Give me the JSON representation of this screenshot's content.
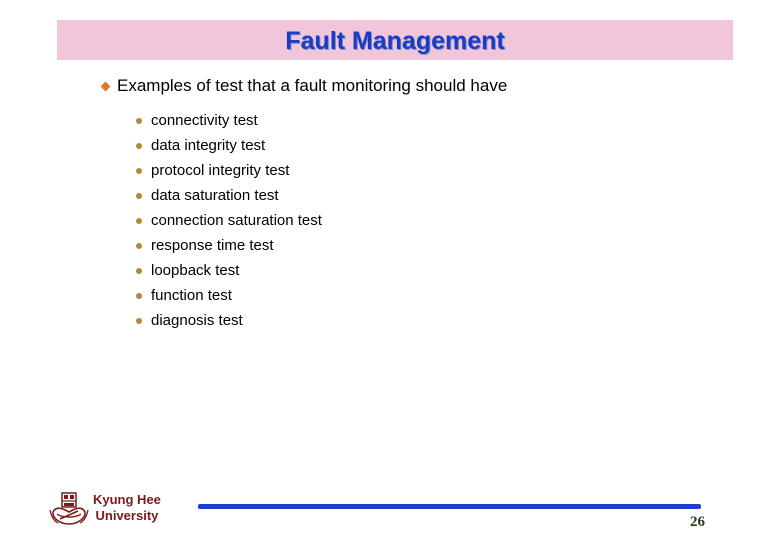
{
  "slide": {
    "title": "Fault Management",
    "main_point": "Examples of test that a fault monitoring should have",
    "sub_items": [
      "connectivity test",
      "data integrity test",
      "protocol integrity test",
      "data saturation test",
      "connection saturation test",
      "response time test",
      "loopback test",
      "function test",
      "diagnosis test"
    ]
  },
  "footer": {
    "university_line1": "Kyung Hee",
    "university_line2": "University",
    "page_number": "26"
  },
  "colors": {
    "title_bg": "#f2c6da",
    "title_text": "#1a3bc4",
    "main_bullet": "#e07a2a",
    "sub_bullet": "#b08a3a",
    "university_text": "#7a1a1a",
    "footer_line": "#1d3fd0"
  },
  "icons": {
    "main_bullet": "diamond-bullet-icon",
    "sub_bullet": "dot-bullet-icon",
    "logo": "university-emblem-icon"
  }
}
